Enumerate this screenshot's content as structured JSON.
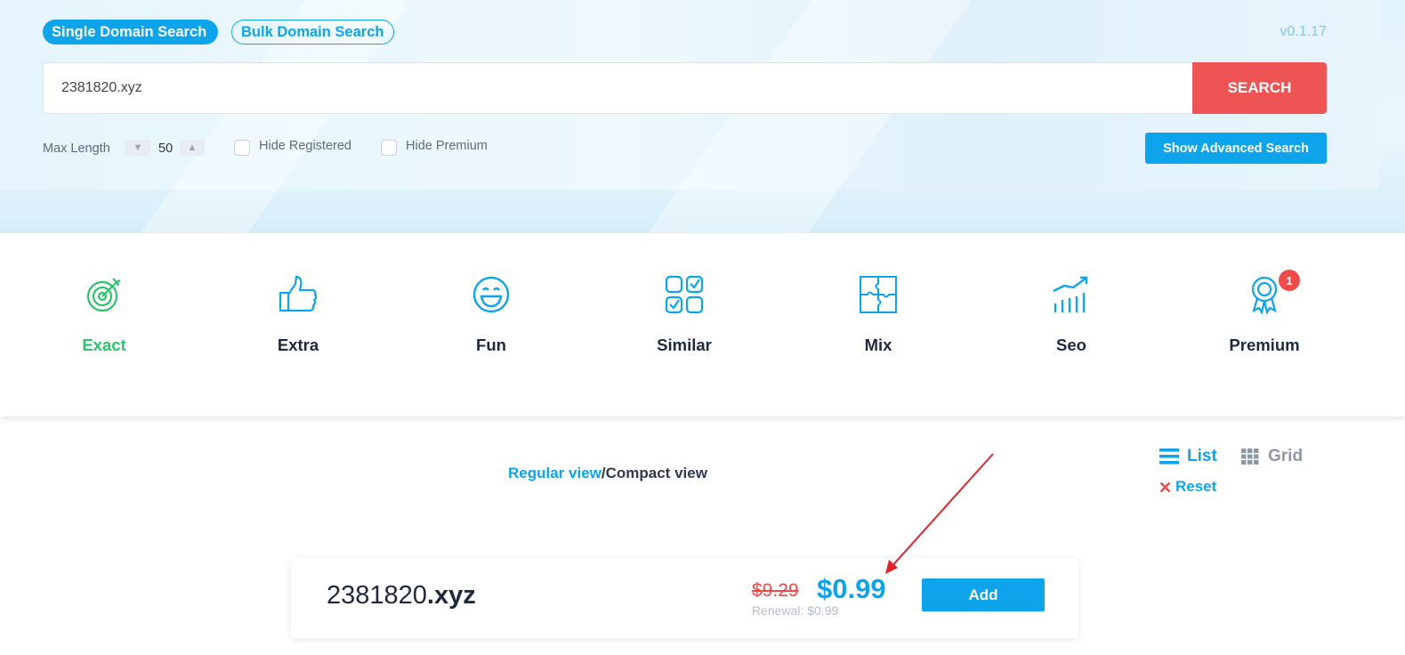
{
  "header": {
    "tabs": [
      {
        "label": "Single Domain Search",
        "active": true
      },
      {
        "label": "Bulk Domain Search",
        "active": false
      }
    ],
    "version": "v0.1.17"
  },
  "search": {
    "value": "2381820.xyz",
    "button_label": "SEARCH",
    "max_length_label": "Max Length",
    "max_length_value": "50",
    "hide_registered_label": "Hide Registered",
    "hide_premium_label": "Hide Premium",
    "advanced_button_label": "Show Advanced Search"
  },
  "categories": [
    {
      "label": "Exact",
      "icon": "target-icon",
      "active": true
    },
    {
      "label": "Extra",
      "icon": "thumbs-up-icon"
    },
    {
      "label": "Fun",
      "icon": "smiley-icon"
    },
    {
      "label": "Similar",
      "icon": "checkbox-grid-icon"
    },
    {
      "label": "Mix",
      "icon": "puzzle-icon"
    },
    {
      "label": "Seo",
      "icon": "chart-growth-icon"
    },
    {
      "label": "Premium",
      "icon": "award-ribbon-icon",
      "badge": "1"
    }
  ],
  "views": {
    "regular": "Regular view",
    "separator": "/",
    "compact": "Compact view"
  },
  "layout": {
    "list_label": "List",
    "grid_label": "Grid",
    "reset_label": "Reset"
  },
  "result": {
    "domain_name": "2381820",
    "tld": ".xyz",
    "old_price": "$9.29",
    "price": "$0.99",
    "renewal": "Renewal: $0.99",
    "add_label": "Add"
  },
  "colors": {
    "accent": "#0ea4ec",
    "danger": "#ef5454",
    "success": "#2ec36a",
    "text": "#1d2a3e"
  }
}
